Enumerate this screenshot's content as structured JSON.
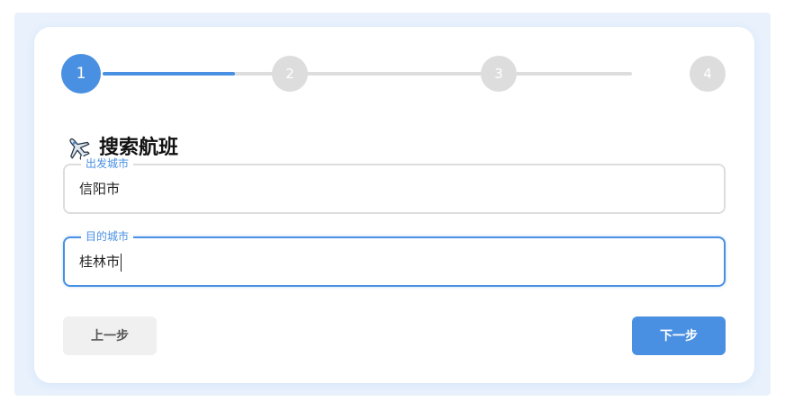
{
  "stepper": {
    "steps": [
      "1",
      "2",
      "3",
      "4"
    ],
    "current_step": 1,
    "progress_fraction": 0.25
  },
  "form": {
    "title": "搜索航班",
    "title_icon": "airplane-icon",
    "from": {
      "legend": "出发城市",
      "value": "信阳市"
    },
    "to": {
      "legend": "目的城市",
      "value": "桂林市"
    }
  },
  "buttons": {
    "prev_label": "上一步",
    "next_label": "下一步"
  },
  "colors": {
    "accent": "#4a90e2",
    "inactive": "#dddddd",
    "backdrop": "#e8f1fc"
  }
}
